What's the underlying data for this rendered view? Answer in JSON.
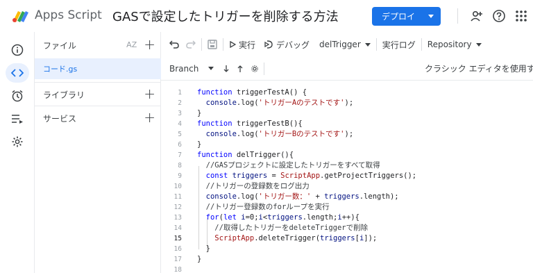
{
  "header": {
    "app_name": "Apps Script",
    "project_title": "GASで設定したトリガーを削除する方法",
    "deploy_label": "デプロイ",
    "icons": [
      "add-user-icon",
      "help-icon",
      "apps-grid-icon"
    ]
  },
  "rail": {
    "items": [
      "info-icon",
      "code-icon",
      "alarm-icon",
      "executions-icon",
      "settings-icon"
    ],
    "active_index": 1
  },
  "files_panel": {
    "files_title": "ファイル",
    "sort_label": "AZ",
    "file_name": "コード.gs",
    "libraries_title": "ライブラリ",
    "services_title": "サービス"
  },
  "toolbar": {
    "run_label": "実行",
    "debug_label": "デバッグ",
    "function_select": "delTrigger",
    "log_label": "実行ログ",
    "repository_label": "Repository",
    "branch_label": "Branch",
    "classic_editor_label": "クラシック エディタを使用す"
  },
  "code": {
    "current_line": 15,
    "lines": [
      "function triggerTestA() {",
      "  console.log('トリガーAのテストです');",
      "}",
      "function triggerTestB(){",
      "  console.log('トリガーBのテストです');",
      "}",
      "function delTrigger(){",
      "  //GASプロジェクトに設定したトリガーをすべて取得",
      "  const triggers = ScriptApp.getProjectTriggers();",
      "  //トリガーの登録数をログ出力",
      "  console.log('トリガー数：' + triggers.length);",
      "  //トリガー登録数のforループを実行",
      "  for(let i=0;i<triggers.length;i++){",
      "    //取得したトリガーをdeleteTriggerで削除",
      "    ScriptApp.deleteTrigger(triggers[i]);",
      "  }",
      "}",
      ""
    ]
  },
  "colors": {
    "accent": "#1a73e8",
    "keyword": "#0000ff",
    "string": "#a31515"
  }
}
